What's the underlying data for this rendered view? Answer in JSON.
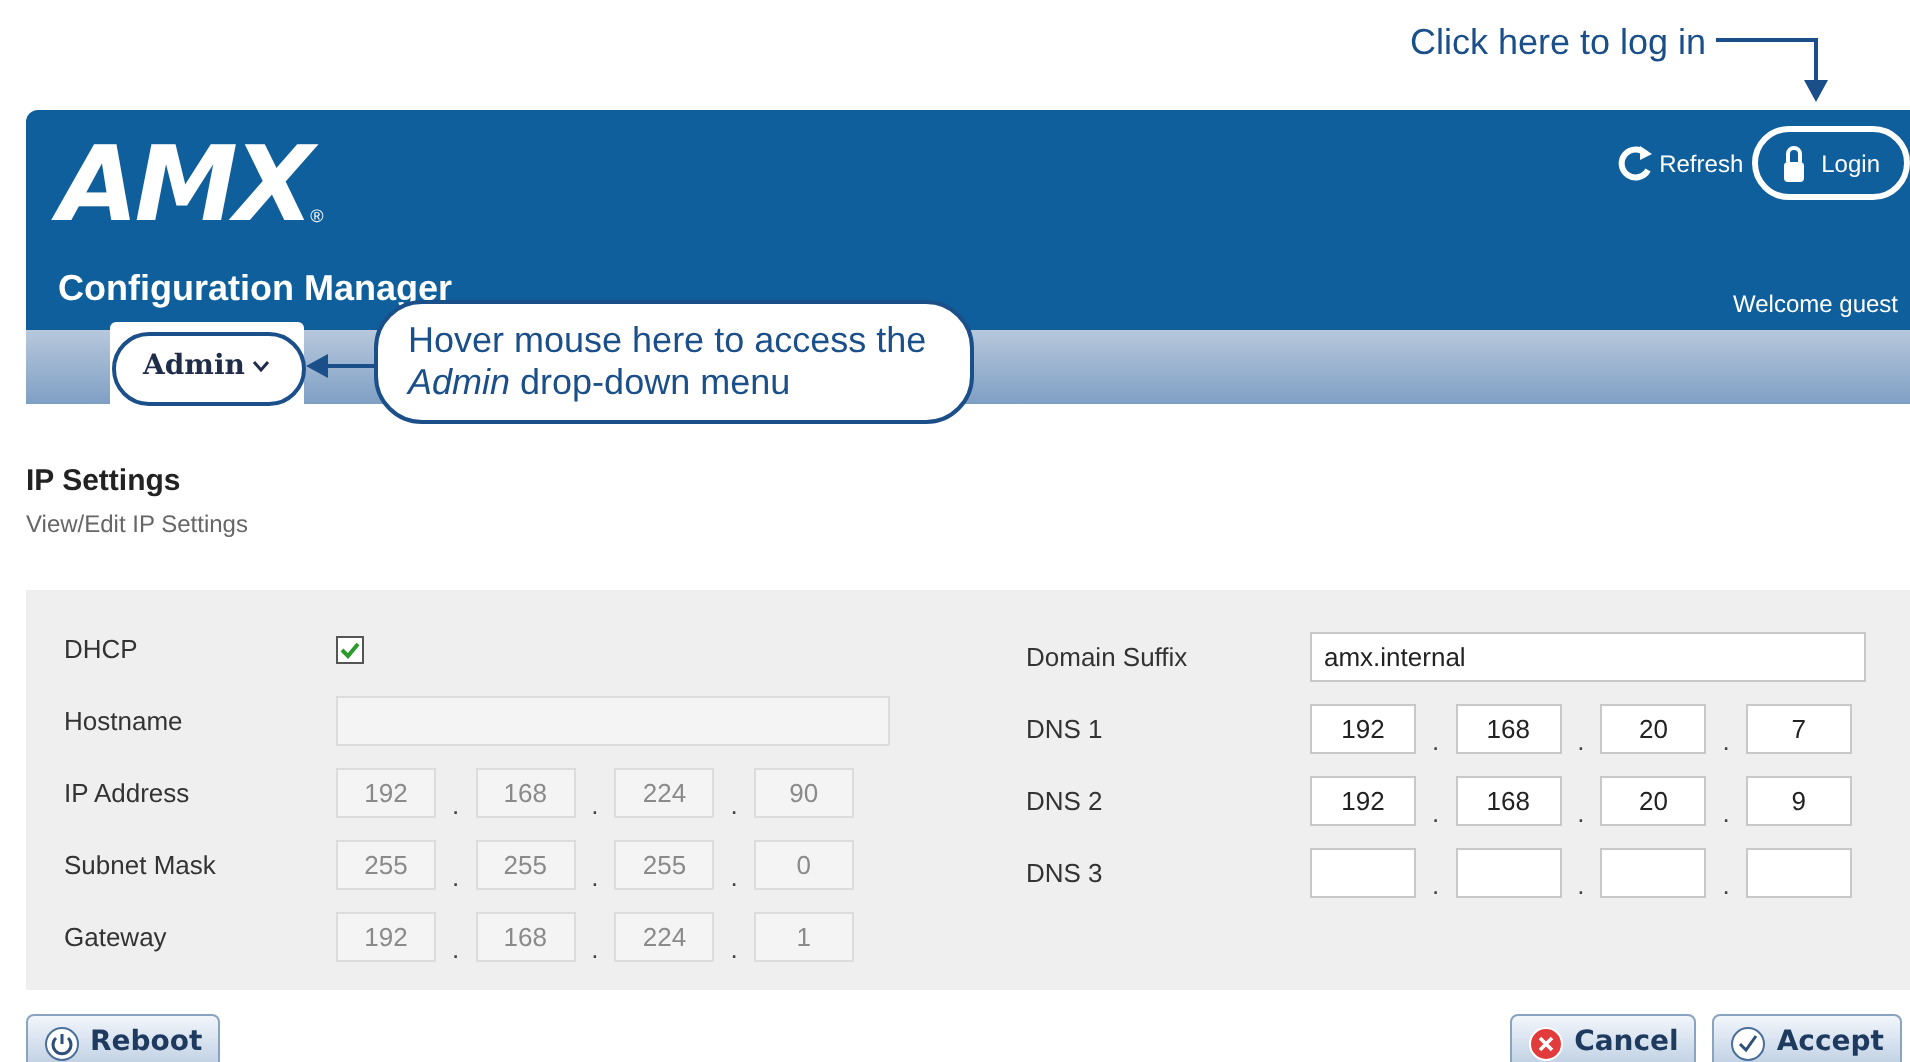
{
  "annotations": [
    {
      "kind": "login",
      "text": "Click here to log in"
    },
    {
      "kind": "admin",
      "text": "Hover mouse here to access the *Admin* drop-down menu"
    }
  ],
  "header": {
    "logo": "AMX",
    "logo_mark": "®",
    "title": "Configuration Manager",
    "refresh": "Refresh",
    "login": "Login",
    "welcome": "Welcome guest"
  },
  "nav": {
    "tabs": [
      {
        "label": "Admin",
        "selected": true
      }
    ]
  },
  "page": {
    "title": "IP Settings",
    "subtitle": "View/Edit IP Settings"
  },
  "left_fields": [
    {
      "kind": "checkbox",
      "label": "DHCP",
      "checked": true
    },
    {
      "kind": "text",
      "label": "Hostname",
      "disabled": true
    },
    {
      "kind": "ip",
      "label": "IP Address",
      "disabled": true,
      "octets": [
        "192",
        "168",
        "224",
        "90"
      ]
    },
    {
      "kind": "ip",
      "label": "Subnet Mask",
      "disabled": true,
      "octets": [
        "255",
        "255",
        "255",
        "0"
      ]
    },
    {
      "kind": "ip",
      "label": "Gateway",
      "disabled": true,
      "octets": [
        "192",
        "168",
        "224",
        "1"
      ]
    }
  ],
  "right_fields": [
    {
      "kind": "text",
      "label": "Domain Suffix",
      "disabled": false,
      "value": "amx.internal"
    },
    {
      "kind": "ip",
      "label": "DNS 1",
      "disabled": false,
      "octets": [
        "192",
        "168",
        "20",
        "7"
      ]
    },
    {
      "kind": "ip",
      "label": "DNS 2",
      "disabled": false,
      "octets": [
        "192",
        "168",
        "20",
        "9"
      ]
    },
    {
      "kind": "ip",
      "label": "DNS 3",
      "disabled": false
    }
  ],
  "buttons": [
    {
      "kind": "reboot",
      "label": "Reboot"
    },
    {
      "kind": "cancel",
      "label": "Cancel"
    },
    {
      "kind": "accept",
      "label": "Accept"
    }
  ],
  "separator": "."
}
